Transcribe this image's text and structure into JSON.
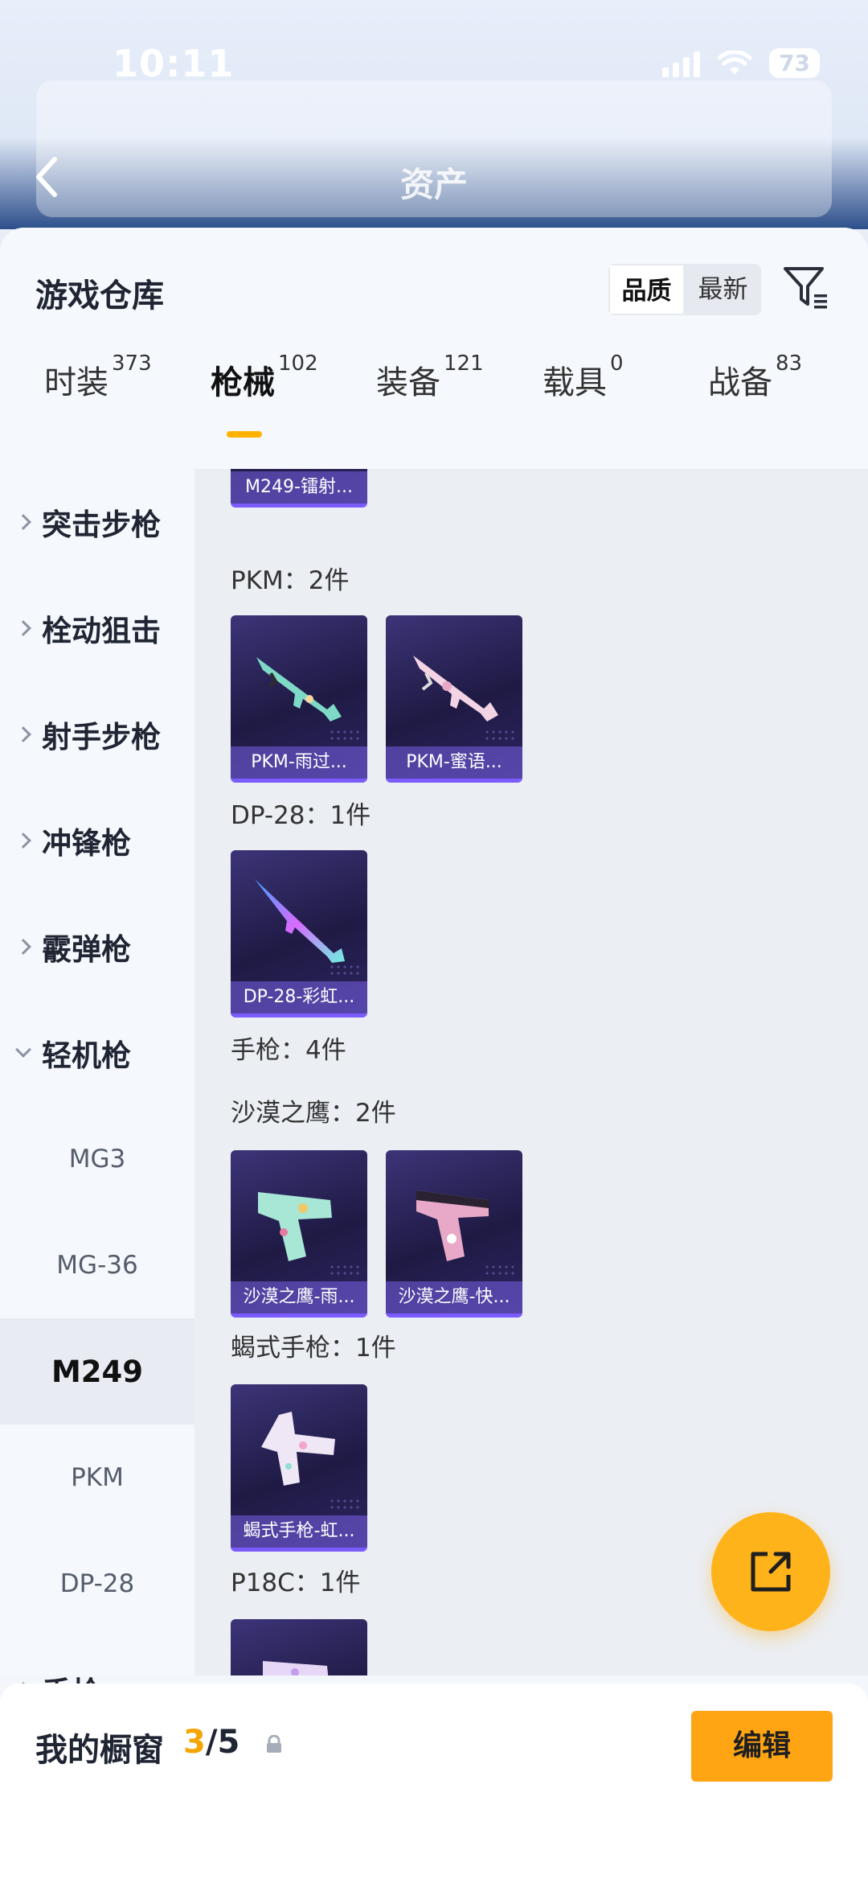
{
  "status_bar": {
    "time": "10:11",
    "battery": "73"
  },
  "top": {
    "title": "资产"
  },
  "sheet": {
    "title": "游戏仓库",
    "sort_options": [
      "品质",
      "最新"
    ],
    "sort_selected": "品质",
    "tabs": [
      {
        "label": "时装",
        "count": "373"
      },
      {
        "label": "枪械",
        "count": "102"
      },
      {
        "label": "装备",
        "count": "121"
      },
      {
        "label": "载具",
        "count": "0"
      },
      {
        "label": "战备",
        "count": "83"
      }
    ],
    "active_tab": "枪械"
  },
  "categories": {
    "items": [
      {
        "label": "突击步枪",
        "expanded": false
      },
      {
        "label": "栓动狙击",
        "expanded": false
      },
      {
        "label": "射手步枪",
        "expanded": false
      },
      {
        "label": "冲锋枪",
        "expanded": false
      },
      {
        "label": "霰弹枪",
        "expanded": false
      },
      {
        "label": "轻机枪",
        "expanded": true
      },
      {
        "label": "手枪",
        "expanded": false
      }
    ],
    "subitems": [
      "MG3",
      "MG-36",
      "M249",
      "PKM",
      "DP-28"
    ],
    "active_subitem": "M249"
  },
  "content": {
    "partial_card": "M249-镭射...",
    "groups": [
      {
        "label": "PKM：2件",
        "cards": [
          "PKM-雨过...",
          "PKM-蜜语..."
        ]
      },
      {
        "label": "DP-28：1件",
        "cards": [
          "DP-28-彩虹..."
        ]
      },
      {
        "label": "手枪：4件",
        "cards": []
      },
      {
        "label": "沙漠之鹰：2件",
        "cards": [
          "沙漠之鹰-雨...",
          "沙漠之鹰-快..."
        ]
      },
      {
        "label": "蝎式手枪：1件",
        "cards": [
          "蝎式手枪-虹..."
        ]
      },
      {
        "label": "P18C：1件",
        "cards": [
          ""
        ]
      }
    ]
  },
  "showcase": {
    "title": "我的橱窗",
    "current": "3",
    "total": "/5",
    "edit_label": "编辑"
  },
  "colors": {
    "accent": "#ffa514",
    "card_bg": "#2a2358",
    "card_border": "#7b5cff"
  },
  "icons": {
    "back": "back-icon",
    "filter": "filter-icon",
    "share": "share-icon",
    "lock": "lock-icon"
  }
}
